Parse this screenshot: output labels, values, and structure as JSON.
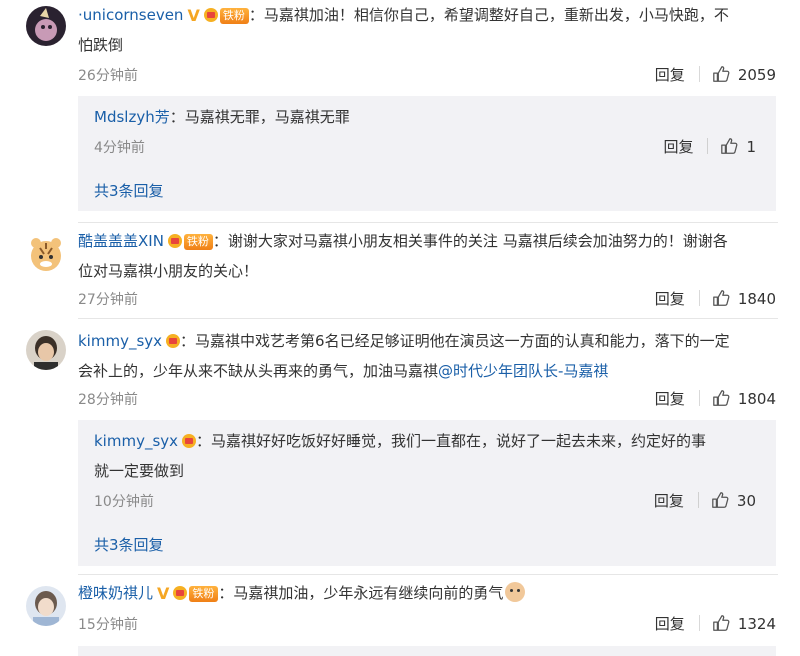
{
  "comments": [
    {
      "username": "·unicornseven",
      "has_v": true,
      "v_label": "V",
      "fan_label": "铁粉",
      "line1": "：马嘉祺加油！相信你自己，希望调整好自己，重新出发，小马快跑，不",
      "line2": "怕跌倒",
      "time": "26分钟前",
      "reply_label": "回复",
      "likes": "2059",
      "replies": [
        {
          "username": "Mdslzyh芳",
          "text": "：马嘉祺无罪，马嘉祺无罪",
          "time": "4分钟前",
          "reply_label": "回复",
          "likes": "1"
        }
      ],
      "more_replies": "共3条回复"
    },
    {
      "username": "酷盖盖盖XIN",
      "fan_label": "铁粉",
      "line1": "：谢谢大家对马嘉祺小朋友相关事件的关注 马嘉祺后续会加油努力的！谢谢各",
      "line2": "位对马嘉祺小朋友的关心！",
      "time": "27分钟前",
      "reply_label": "回复",
      "likes": "1840"
    },
    {
      "username": "kimmy_syx",
      "line1": "：马嘉祺中戏艺考第6名已经足够证明他在演员这一方面的认真和能力，落下的一定",
      "line2_prefix": "会补上的，少年从来不缺从头再来的勇气，加油马嘉祺",
      "line2_link": "@时代少年团队长-马嘉祺",
      "time": "28分钟前",
      "reply_label": "回复",
      "likes": "1804",
      "replies": [
        {
          "username": "kimmy_syx",
          "text": "：马嘉祺好好吃饭好好睡觉，我们一直都在，说好了一起去未来，约定好的事",
          "text2": "就一定要做到",
          "time": "10分钟前",
          "reply_label": "回复",
          "likes": "30"
        }
      ],
      "more_replies": "共3条回复"
    },
    {
      "username": "橙味奶祺儿",
      "v_label": "V",
      "fan_label": "铁粉",
      "line1": "：马嘉祺加油，少年永远有继续向前的勇气",
      "time": "15分钟前",
      "reply_label": "回复",
      "likes": "1324"
    }
  ],
  "colors": {
    "link": "#1a5fa8",
    "meta": "#8a8a8a",
    "reply_bg": "#f2f2f5",
    "v_badge": "#f5a623",
    "fan_badge": "#f07f16"
  },
  "icons": {
    "like": "thumb-up-icon",
    "crown": "crown-badge-icon",
    "verified": "verified-v-icon",
    "emoji": "dog-face-emoji-icon"
  }
}
